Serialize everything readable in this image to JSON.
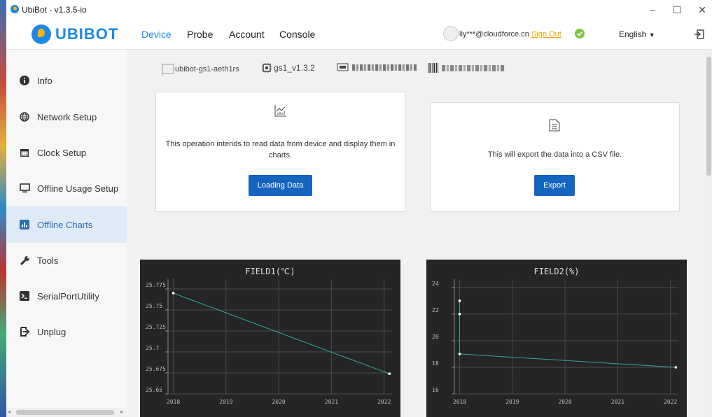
{
  "window": {
    "title": "UbiBot - v1.3.5-io"
  },
  "logo": {
    "text": "UBIBOT"
  },
  "nav": {
    "items": [
      "Device",
      "Probe",
      "Account",
      "Console"
    ],
    "user_email": "liy***@cloudforce.cn",
    "sign_out": "Sign Out",
    "language": "English"
  },
  "sidebar": {
    "items": [
      {
        "label": "Info",
        "icon": "info-icon"
      },
      {
        "label": "Network Setup",
        "icon": "globe-icon"
      },
      {
        "label": "Clock Setup",
        "icon": "calendar-icon"
      },
      {
        "label": "Offline Usage Setup",
        "icon": "monitor-icon"
      },
      {
        "label": "Offline Charts",
        "icon": "bar-chart-icon"
      },
      {
        "label": "Tools",
        "icon": "wrench-icon"
      },
      {
        "label": "SerialPortUtility",
        "icon": "terminal-icon"
      },
      {
        "label": "Unplug",
        "icon": "unplug-icon"
      }
    ]
  },
  "device": {
    "name": "ubibot-gs1-aeth1rs",
    "firmware": "gs1_v1.3.2"
  },
  "cards": {
    "load": {
      "description": "This operation intends to read data from device and display them in charts.",
      "button": "Loading Data"
    },
    "export": {
      "description": "This will export the data into a CSV file.",
      "button": "Export"
    }
  },
  "chart_data": [
    {
      "type": "line",
      "title": "FIELD1(℃)",
      "x": [
        2018,
        2022.1
      ],
      "y": [
        25.77,
        25.674
      ],
      "xticks": [
        "2018",
        "2019",
        "2020",
        "2021",
        "2022"
      ],
      "yticks": [
        "25.65",
        "25.675",
        "25.7",
        "25.725",
        "25.75",
        "25.775"
      ],
      "xlim": [
        2017.9,
        2022.15
      ],
      "ylim": [
        25.65,
        25.78
      ],
      "grid": true,
      "colors": {
        "line": "#2fa7a0",
        "background": "#252525"
      }
    },
    {
      "type": "line",
      "title": "FIELD2(%)",
      "x": [
        2018,
        2018,
        2018,
        2022.1
      ],
      "y": [
        23,
        22,
        19,
        18
      ],
      "xticks": [
        "2018",
        "2019",
        "2020",
        "2021",
        "2022"
      ],
      "yticks": [
        "16",
        "18",
        "20",
        "22",
        "24"
      ],
      "xlim": [
        2017.9,
        2022.15
      ],
      "ylim": [
        16,
        24.2
      ],
      "grid": true,
      "colors": {
        "line": "#2fa7a0",
        "background": "#252525"
      }
    }
  ]
}
